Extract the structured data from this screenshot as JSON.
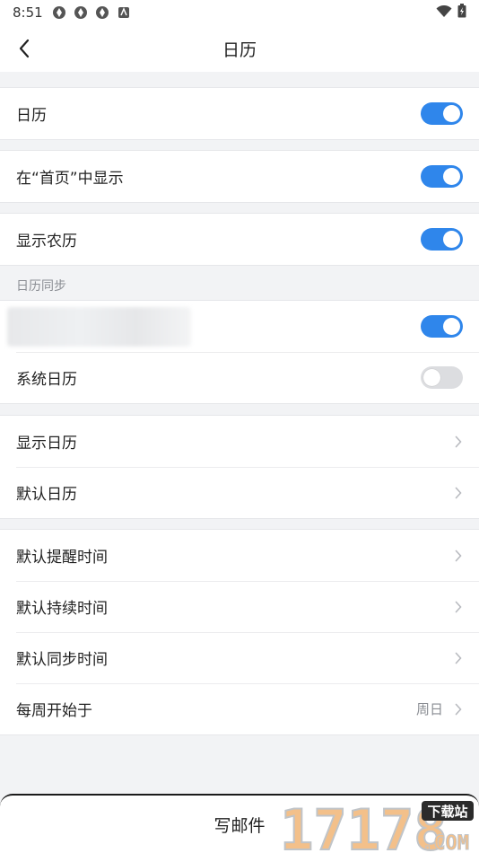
{
  "status": {
    "time": "8:51"
  },
  "nav": {
    "title": "日历"
  },
  "settings": {
    "calendar": {
      "label": "日历",
      "on": true
    },
    "show_on_home": {
      "label": "在“首页”中显示",
      "on": true
    },
    "lunar": {
      "label": "显示农历",
      "on": true
    },
    "sync_header": "日历同步",
    "sync_account": {
      "on": true
    },
    "system_calendar": {
      "label": "系统日历",
      "on": false
    },
    "show_calendar": {
      "label": "显示日历"
    },
    "default_calendar": {
      "label": "默认日历"
    },
    "default_reminder": {
      "label": "默认提醒时间"
    },
    "default_duration": {
      "label": "默认持续时间"
    },
    "default_sync": {
      "label": "默认同步时间"
    },
    "week_start": {
      "label": "每周开始于",
      "value": "周日"
    }
  },
  "bottom": {
    "compose_label": "写邮件"
  },
  "watermark": {
    "number": "17178",
    "badge": "下载站",
    "suffix": ".COM"
  },
  "colors": {
    "accent": "#2f86eb",
    "toggle_off": "#dcdde0",
    "background": "#f2f3f5"
  }
}
